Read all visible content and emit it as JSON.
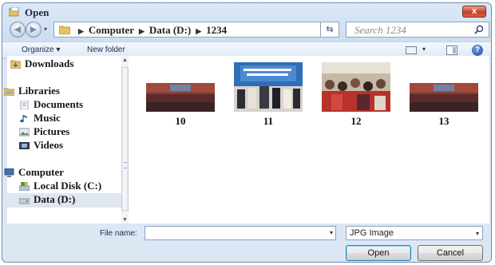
{
  "window": {
    "title": "Open",
    "close_label": "x"
  },
  "nav": {
    "back_icon": "back-arrow-icon",
    "forward_icon": "forward-arrow-icon"
  },
  "address": {
    "crumbs": [
      "Computer",
      "Data (D:)",
      "1234"
    ]
  },
  "search": {
    "placeholder": "Search 1234"
  },
  "toolbar": {
    "organize_label": "Organize ▾",
    "new_folder_label": "New folder"
  },
  "sidebar": {
    "items": [
      {
        "label": "Downloads",
        "icon": "downloads-icon"
      },
      {
        "label": "Libraries",
        "icon": "libraries-icon"
      },
      {
        "label": "Documents",
        "icon": "documents-icon"
      },
      {
        "label": "Music",
        "icon": "music-icon"
      },
      {
        "label": "Pictures",
        "icon": "pictures-icon"
      },
      {
        "label": "Videos",
        "icon": "videos-icon"
      },
      {
        "label": "Computer",
        "icon": "computer-icon"
      },
      {
        "label": "Local Disk (C:)",
        "icon": "local-disk-icon"
      },
      {
        "label": "Data (D:)",
        "icon": "drive-icon"
      }
    ],
    "selected": "Data (D:)"
  },
  "files": [
    {
      "name": "10"
    },
    {
      "name": "11"
    },
    {
      "name": "12"
    },
    {
      "name": "13"
    }
  ],
  "file_name": {
    "label": "File name:",
    "value": ""
  },
  "file_type": {
    "selected": "JPG Image"
  },
  "buttons": {
    "open_label": "Open",
    "cancel_label": "Cancel"
  },
  "colors": {
    "accent": "#3c7fb1",
    "close": "#c6412a",
    "frame": "#dbe8f7"
  }
}
